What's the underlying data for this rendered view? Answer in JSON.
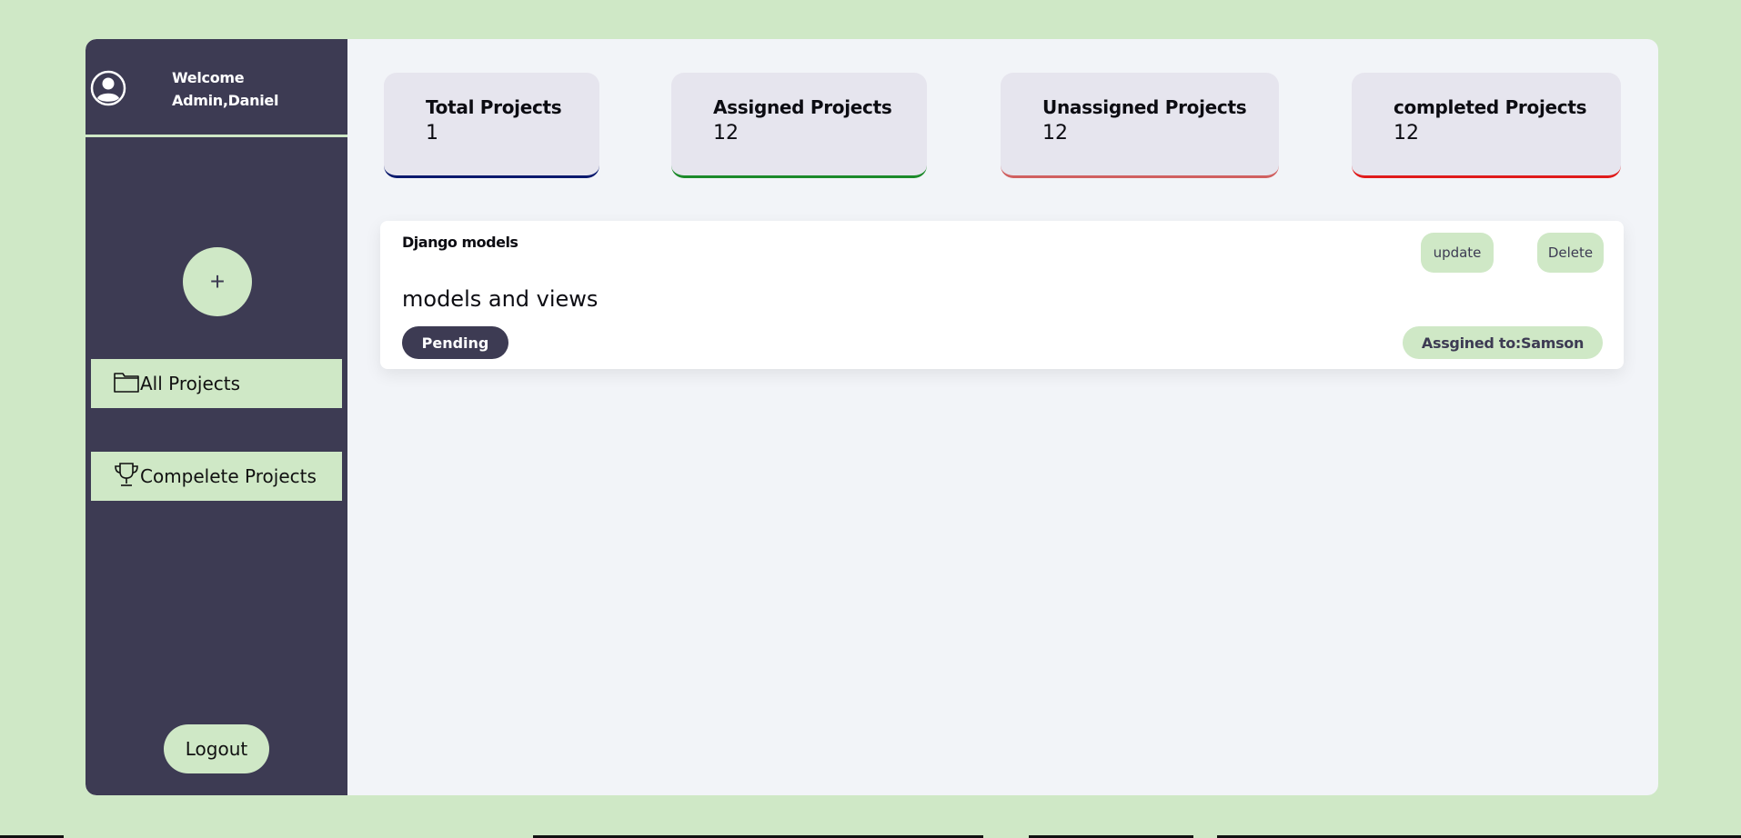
{
  "sidebar": {
    "welcome_line1": "Welcome",
    "welcome_line2": "Admin,Daniel",
    "add_label": "+",
    "items": [
      {
        "label": "All Projects",
        "icon": "folder-icon"
      },
      {
        "label": "Compelete Projects",
        "icon": "trophy-icon"
      }
    ],
    "logout_label": "Logout"
  },
  "stats": [
    {
      "label": "Total Projects",
      "value": "1"
    },
    {
      "label": "Assigned Projects",
      "value": "12"
    },
    {
      "label": "Unassigned Projects",
      "value": "12"
    },
    {
      "label": "completed Projects",
      "value": "12"
    }
  ],
  "project": {
    "title": "Django models",
    "description": "models and views",
    "update_label": "update",
    "delete_label": "Delete",
    "status": "Pending",
    "assigned_to": "Assgined to:Samson"
  },
  "colors": {
    "accent": "#cfe8c6",
    "sidebar": "#3d3b53",
    "total_border": "#0b1a6e",
    "assigned_border": "#1c8a2a",
    "unassigned_border": "#d06060",
    "completed_border": "#e01b1b"
  }
}
